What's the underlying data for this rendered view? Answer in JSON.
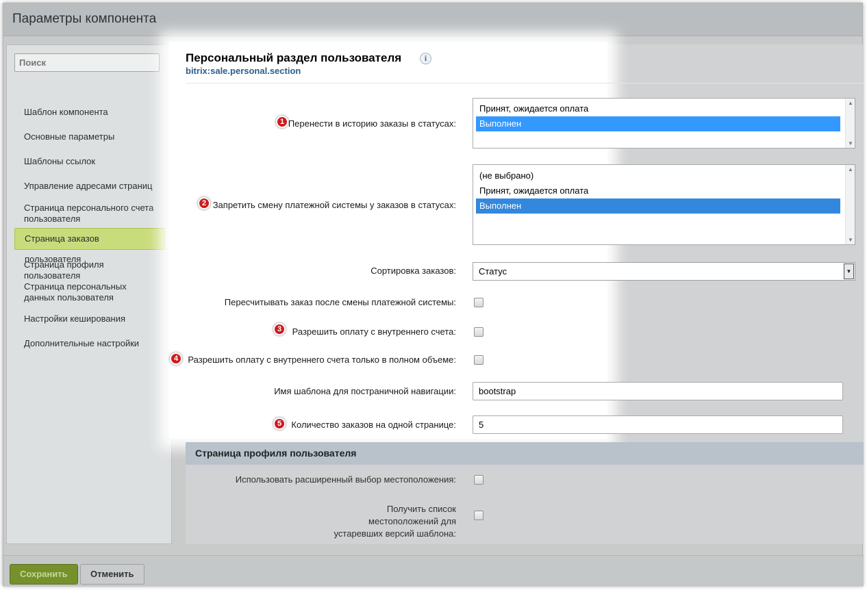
{
  "window": {
    "title": "Параметры компонента"
  },
  "sidebar": {
    "search_placeholder": "Поиск",
    "items": [
      {
        "label": "Шаблон компонента"
      },
      {
        "label": "Основные параметры"
      },
      {
        "label": "Шаблоны ссылок"
      },
      {
        "label": "Управление адресами страниц"
      },
      {
        "label": "Страница персонального счета пользователя"
      },
      {
        "label": "Страница заказов пользователя",
        "active": true
      },
      {
        "label": "Страница профиля пользователя"
      },
      {
        "label": "Страница персональных данных пользователя"
      },
      {
        "label": "Настройки кеширования"
      },
      {
        "label": "Дополнительные настройки"
      }
    ]
  },
  "main": {
    "heading": "Персональный раздел пользователя",
    "info_icon": "i",
    "component_code": "bitrix:sale.personal.section",
    "fields": {
      "history_statuses": {
        "badge": "1",
        "label": "Перенести в историю заказы в статусах:",
        "options": [
          {
            "label": "Принят, ожидается оплата",
            "selected": false
          },
          {
            "label": "Выполнен",
            "selected": true
          }
        ]
      },
      "forbid_payment_change": {
        "badge": "2",
        "label": "Запретить смену платежной системы у заказов в статусах:",
        "options": [
          {
            "label": "(не выбрано)",
            "selected": false
          },
          {
            "label": "Принят, ожидается оплата",
            "selected": false
          },
          {
            "label": "Выполнен",
            "selected": true
          }
        ]
      },
      "sort_orders": {
        "label": "Сортировка заказов:",
        "value": "Статус"
      },
      "recalc_order": {
        "label": "Пересчитывать заказ после смены платежной системы:",
        "checked": false
      },
      "allow_inner_pay": {
        "badge": "3",
        "label": "Разрешить оплату с внутреннего счета:",
        "checked": false
      },
      "allow_inner_pay_full": {
        "badge": "4",
        "label": "Разрешить оплату с внутреннего счета только в полном объеме:",
        "checked": false
      },
      "nav_template": {
        "label": "Имя шаблона для постраничной навигации:",
        "value": "bootstrap"
      },
      "orders_per_page": {
        "badge": "5",
        "label": "Количество заказов на одной странице:",
        "value": "5"
      }
    },
    "profile_section": {
      "title": "Страница профиля пользователя",
      "extended_location": {
        "label": "Использовать расширенный выбор местоположения:",
        "checked": false
      },
      "legacy_locations": {
        "label": "Получить список местоположений для устаревших версий шаблона:",
        "checked": false
      }
    }
  },
  "footer": {
    "save_label": "Сохранить",
    "cancel_label": "Отменить"
  },
  "colors": {
    "badge": "#cf1c1f",
    "selected_option": "#3399ff",
    "active_nav": "#c9dc7c",
    "save_button": "#76902b",
    "link": "#2a5e8c"
  }
}
